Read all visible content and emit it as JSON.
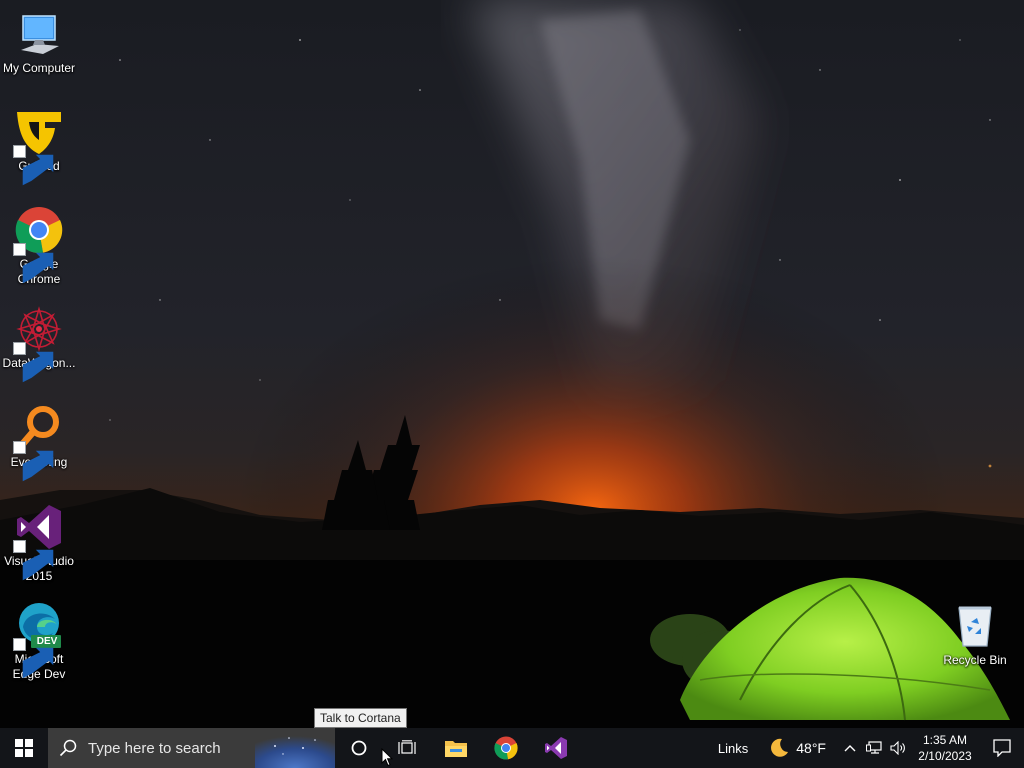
{
  "desktop": {
    "icons": [
      {
        "name": "My Computer",
        "label": "My Computer"
      },
      {
        "name": "Guilded",
        "label": "Guilded"
      },
      {
        "name": "Google Chrome",
        "label": "Google Chrome"
      },
      {
        "name": "DataWagon",
        "label": "DataWagon..."
      },
      {
        "name": "Everything",
        "label": "Everything"
      },
      {
        "name": "Visual Studio 2015",
        "label": "Visual Studio 2015"
      },
      {
        "name": "Microsoft Edge Dev",
        "label": "Microsoft Edge Dev",
        "badge": "DEV"
      },
      {
        "name": "Recycle Bin",
        "label": "Recycle Bin"
      }
    ]
  },
  "tooltip": {
    "text": "Talk to Cortana"
  },
  "taskbar": {
    "search_placeholder": "Type here to search",
    "links_label": "Links",
    "weather": {
      "temp": "48°F",
      "icon": "moon-icon"
    },
    "clock": {
      "time": "1:35 AM",
      "date": "2/10/2023"
    },
    "pinned_apps": [
      "file-explorer-icon",
      "chrome-icon",
      "visual-studio-icon"
    ]
  },
  "colors": {
    "taskbar_bg": "#14161a",
    "search_bg": "#3b3b3b",
    "tent_green": "#8fd62a",
    "horizon_glow": "#ff6a10"
  }
}
